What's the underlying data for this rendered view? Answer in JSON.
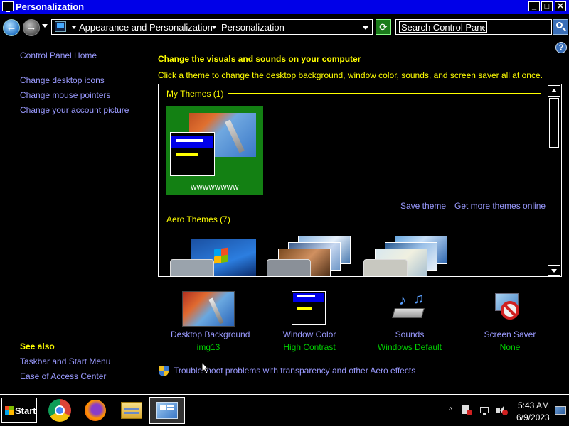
{
  "window": {
    "title": "Personalization",
    "buttons": {
      "minimize": "_",
      "maximize": "□",
      "close": "✕"
    }
  },
  "address": {
    "crumbs": [
      "Appearance and Personalization",
      "Personalization"
    ],
    "search_placeholder": "Search Control Panel"
  },
  "sidebar": {
    "home": "Control Panel Home",
    "links": [
      "Change desktop icons",
      "Change mouse pointers",
      "Change your account picture"
    ],
    "see_also_title": "See also",
    "see_also": [
      "Taskbar and Start Menu",
      "Ease of Access Center"
    ]
  },
  "main": {
    "heading": "Change the visuals and sounds on your computer",
    "subheading": "Click a theme to change the desktop background, window color, sounds, and screen saver all at once.",
    "my_themes_label": "My Themes (1)",
    "my_theme_name": "wwwwwwww",
    "save_theme": "Save theme",
    "get_more": "Get more themes online",
    "aero_label": "Aero Themes (7)"
  },
  "customize": [
    {
      "label": "Desktop Background",
      "value": "img13",
      "icon": "desktop-background-icon"
    },
    {
      "label": "Window Color",
      "value": "High Contrast",
      "icon": "window-color-icon"
    },
    {
      "label": "Sounds",
      "value": "Windows Default",
      "icon": "sounds-icon"
    },
    {
      "label": "Screen Saver",
      "value": "None",
      "icon": "screen-saver-icon"
    }
  ],
  "troubleshoot": "Troubleshoot problems with transparency and other Aero effects",
  "taskbar": {
    "start": "Start",
    "apps": [
      "chrome-icon",
      "firefox-icon",
      "file-explorer-icon",
      "control-panel-icon"
    ],
    "time": "5:43 AM",
    "date": "6/9/2023"
  },
  "colors": {
    "titlebar": "#0000e8",
    "heading": "#ffff00",
    "link": "#9a9aff",
    "value": "#00d000",
    "theme_tile": "#138013"
  }
}
